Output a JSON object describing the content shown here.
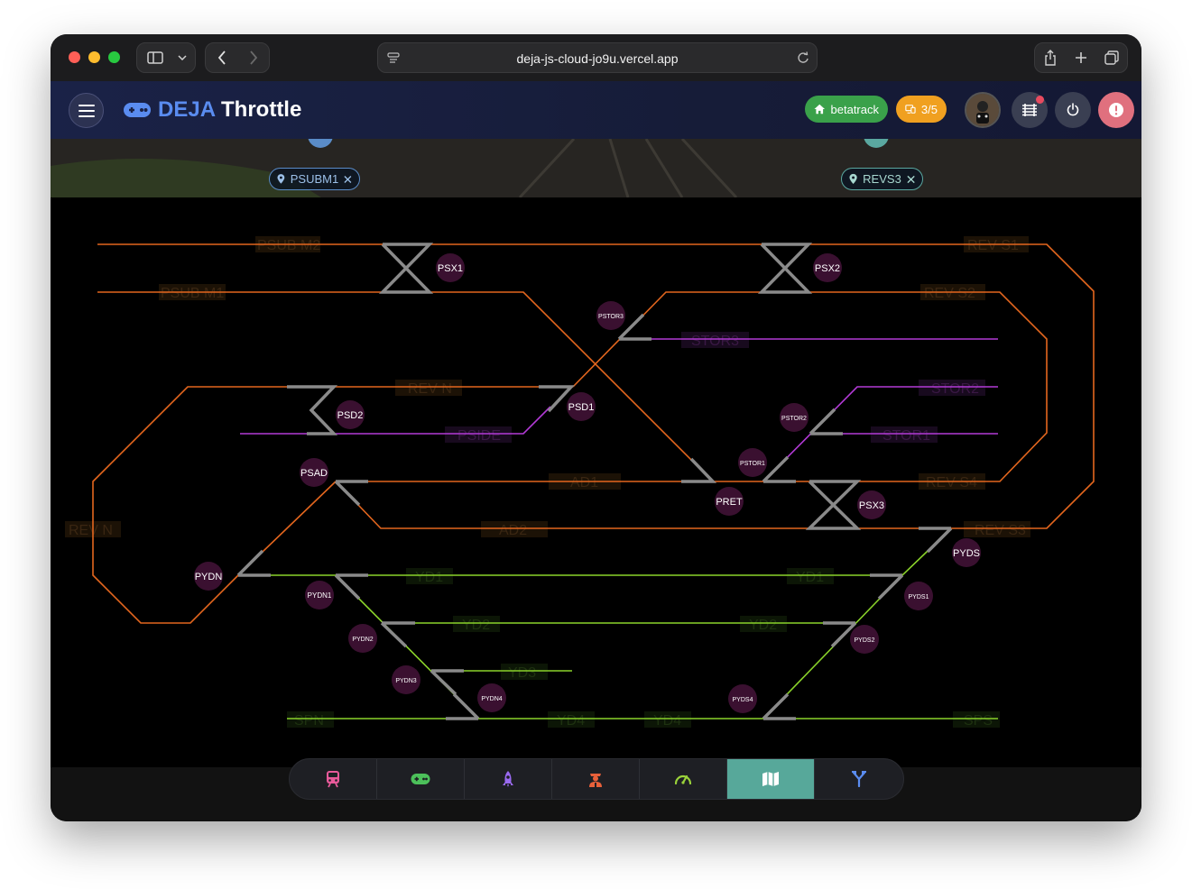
{
  "browser": {
    "url": "deja-js-cloud-jo9u.vercel.app"
  },
  "app": {
    "brand_prefix": "DEJA",
    "brand_title": "Throttle",
    "layout_badge": "betatrack",
    "devices_badge": "3/5"
  },
  "location_chips": [
    {
      "label": "PSUBM1"
    },
    {
      "label": "REVS3"
    }
  ],
  "track_blocks": [
    "PSUB M2",
    "PSUB M1",
    "REV S1",
    "REV S2",
    "STOR3",
    "STOR2",
    "STOR1",
    "REV N",
    "PSIDE",
    "AD1",
    "AD2",
    "REV S4",
    "REV S3",
    "REV N",
    "YD1",
    "YD1",
    "YD2",
    "YD2",
    "YD3",
    "YD4",
    "YD4",
    "SPN",
    "SPS"
  ],
  "turnouts": [
    "PSX1",
    "PSX2",
    "PSTOR3",
    "PSD1",
    "PSD2",
    "PSTOR2",
    "PSTOR1",
    "PSAD",
    "PRET",
    "PSX3",
    "PYDS",
    "PYDN",
    "PYDN1",
    "PYDS1",
    "PYDN2",
    "PYDS2",
    "PYDN3",
    "PYDN4",
    "PYDS4"
  ],
  "colors": {
    "mainline": "#e3661e",
    "storage": "#b23ad6",
    "yard": "#8ad22a",
    "turnout": "#8a8a8a",
    "turnout_marker": "#3a1030",
    "active_tab": "#57a89a",
    "brand_blue": "#5a8cf0",
    "badge_green": "#3aa14a",
    "badge_orange": "#f0a020"
  },
  "nav_tabs": [
    {
      "icon": "train-icon",
      "color": "#e85a9a",
      "active": false
    },
    {
      "icon": "gamepad-icon",
      "color": "#4cc05a",
      "active": false
    },
    {
      "icon": "rocket-icon",
      "color": "#9a6af0",
      "active": false
    },
    {
      "icon": "conductor-icon",
      "color": "#e8603a",
      "active": false
    },
    {
      "icon": "speedometer-icon",
      "color": "#9ad23a",
      "active": false
    },
    {
      "icon": "map-icon",
      "color": "#ffffff",
      "active": true
    },
    {
      "icon": "turnout-icon",
      "color": "#5a8cf0",
      "active": false
    }
  ]
}
